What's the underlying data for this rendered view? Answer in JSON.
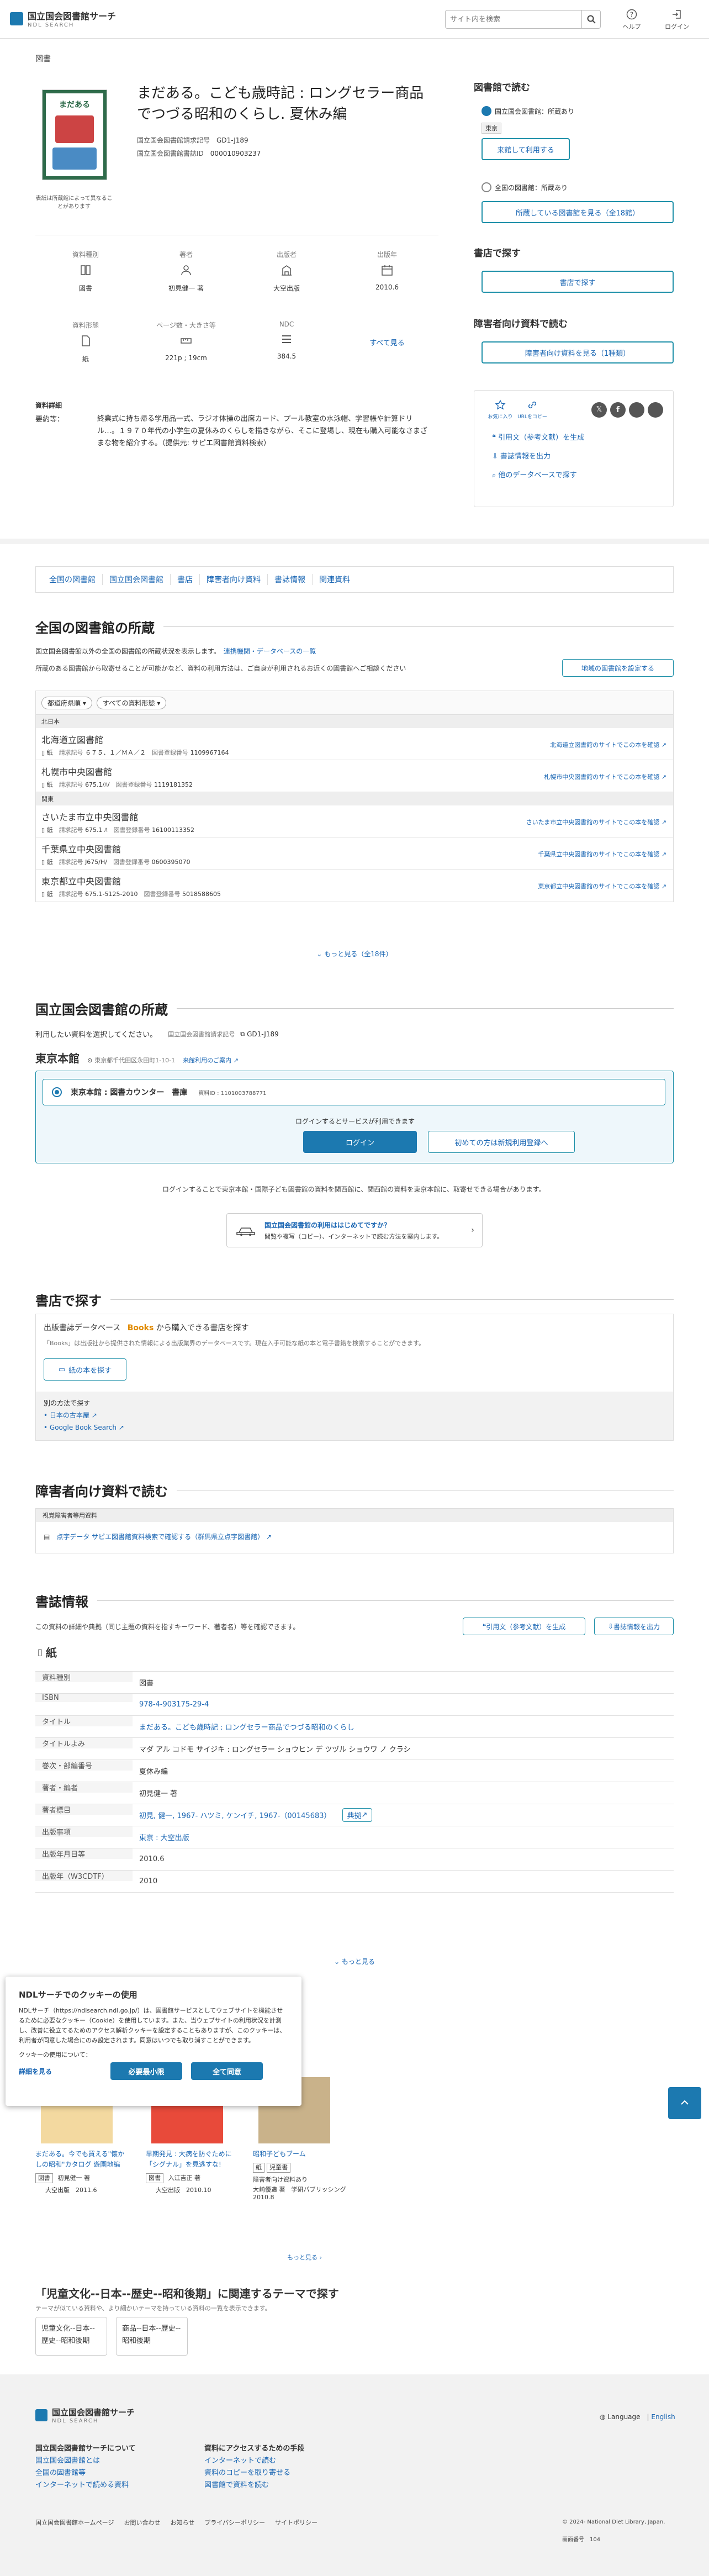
{
  "header": {
    "logo_ja": "国立国会図書館サーチ",
    "logo_en": "NDL SEARCH",
    "search_placeholder": "サイト内を検索",
    "help": "ヘルプ",
    "login": "ログイン"
  },
  "breadcrumb": "図書",
  "book": {
    "title": "まだある。こども歳時記 : ロングセラー商品でつづる昭和のくらし. 夏休み編",
    "call_label": "国立国会図書館請求記号",
    "call": "GD1-J189",
    "reg_label": "国立国会図書館書誌ID",
    "reg": "000010903237",
    "cover_note": "表紙は所蔵館によって異なることがあります",
    "cover_text": "まだある",
    "summary_label": "資料詳細",
    "summary_key": "要約等：",
    "summary": "終業式に持ち帰る学用品一式、ラジオ体操の出席カード、プール教室の水泳帽、学習帳や計算ドリル…。１９７０年代の小学生の夏休みのくらしを描きながら、そこに登場し、現在も購入可能なさまざまな物を紹介する。（提供元: サピエ図書館資料検索）"
  },
  "facets": [
    {
      "label": "資料種別",
      "value": "図書",
      "icon": "book-icon"
    },
    {
      "label": "著者",
      "value": "初見健一 著",
      "icon": "person-icon"
    },
    {
      "label": "出版者",
      "value": "大空出版",
      "icon": "building-icon"
    },
    {
      "label": "出版年",
      "value": "2010.6",
      "icon": "calendar-icon"
    },
    {
      "label": "資料形態",
      "value": "紙",
      "icon": "paper-icon"
    },
    {
      "label": "ページ数・大きさ等",
      "value": "221p ; 19cm",
      "icon": "ruler-icon"
    },
    {
      "label": "NDC",
      "value": "384.5",
      "icon": "ndc-icon"
    }
  ],
  "see_all": "すべて見る",
  "side": {
    "read_title": "図書館で読む",
    "ndl_hold": "国立国会図書館：所蔵あり",
    "tokyo": "東京",
    "visit_btn": "来館して利用する",
    "pub_hold": "全国の図書館：所蔵あり",
    "pub_btn": "所蔵している図書館を見る（全18館）",
    "store_title": "書店で探す",
    "store_btn": "書店で探す",
    "dis_title": "障害者向け資料で読む",
    "dis_btn": "障害者向け資料を見る（1種類）",
    "fav": "お気に入り",
    "url": "URLをコピー",
    "cite": "引用文（参考文献）を生成",
    "export": "書誌情報を出力",
    "other_db": "他のデータベースで探す"
  },
  "tabs": [
    "全国の図書館",
    "国立国会図書館",
    "書店",
    "障害者向け資料",
    "書誌情報",
    "関連資料"
  ],
  "national": {
    "title": "全国の図書館の所蔵",
    "desc": "国立国会図書館以外の全国の図書館の所蔵状況を表示します。",
    "link": "連携機関・データベースの一覧",
    "desc2": "所蔵のある図書館から取寄せることが可能かなど、資料の利用方法は、ご自身が利用されるお近くの図書館へご相談ください",
    "set_btn": "地域の図書館を設定する",
    "filter1": "都道府県順",
    "filter2": "すべての資料形態",
    "groups": [
      {
        "region": "北日本",
        "libs": [
          {
            "name": "北海道立図書館",
            "kind": "紙",
            "call_label": "請求記号",
            "call": "６７５．１／ＭＡ／２",
            "reg_label": "図書登録番号",
            "reg": "1109967164",
            "link": "北海道立図書館のサイトでこの本を確認"
          },
          {
            "name": "札幌市中央図書館",
            "kind": "紙",
            "call_label": "請求記号",
            "call": "675.1/ﾊ/",
            "reg_label": "図書登録番号",
            "reg": "1119181352",
            "link": "札幌市中央図書館のサイトでこの本を確認"
          }
        ]
      },
      {
        "region": "関東",
        "libs": [
          {
            "name": "さいたま市立中央図書館",
            "kind": "紙",
            "call_label": "請求記号",
            "call": "675.1 ﾊ",
            "reg_label": "図書登録番号",
            "reg": "16100113352",
            "link": "さいたま市立中央図書館のサイトでこの本を確認"
          },
          {
            "name": "千葉県立中央図書館",
            "kind": "紙",
            "call_label": "請求記号",
            "call": "J675/H/",
            "reg_label": "図書登録番号",
            "reg": "0600395070",
            "link": "千葉県立中央図書館のサイトでこの本を確認"
          },
          {
            "name": "東京都立中央図書館",
            "kind": "紙",
            "call_label": "請求記号",
            "call": "675.1-5125-2010",
            "reg_label": "図書登録番号",
            "reg": "5018588605",
            "link": "東京都立中央図書館のサイトでこの本を確認"
          }
        ]
      }
    ],
    "more": "もっと見る（全18件）"
  },
  "ndl": {
    "title": "国立国会図書館の所蔵",
    "desc": "利用したい資料を選択してください。",
    "call_label": "国立国会図書館請求記号",
    "call": "GD1-J189",
    "branch": "東京本館",
    "address": "東京都千代田区永田町1-10-1",
    "howto": "来館利用のご案内",
    "item": "東京本館 : 図書カウンター　書庫",
    "item_id": "資料ID : 1101003788771",
    "login_note": "ログインするとサービスが利用できます",
    "login_btn": "ログイン",
    "register_btn": "初めての方は新規利用登録へ",
    "note": "ログインすることで東京本館・国際子ども図書館の資料を関西館に、関西館の資料を東京本館に、取寄せできる場合があります。",
    "guide_title": "国立国会図書館の利用ははじめてですか？",
    "guide_text": "閲覧や複写（コピー）、インターネットで読む方法を案内します。"
  },
  "store": {
    "title": "書店で探す",
    "db": "出版書誌データベース",
    "books_logo": "Books",
    "db_suffix": "から購入できる書店を探す",
    "desc": "「Books」は出版社から提供された情報による出版業界のデータベースです。現在入手可能な紙の本と電子書籍を検索することができます。",
    "btn": "紙の本を探す",
    "other": "別の方法で探す",
    "l1": "日本の古本屋",
    "l2": "Google Book Search"
  },
  "disab": {
    "title": "障害者向け資料で読む",
    "head": "視覚障害者等用資料",
    "link": "点字データ サピエ図書館資料検索で確認する（群馬県立点字図書館）"
  },
  "biblio": {
    "title": "書誌情報",
    "desc": "この資料の詳細や典拠（同じ主題の資料を指すキーワード、著者名）等を確認できます。",
    "cite": "引用文（参考文献）を生成",
    "export": "書誌情報を出力",
    "kind": "紙",
    "rows": [
      {
        "k": "資料種別",
        "v": "図書"
      },
      {
        "k": "ISBN",
        "v": "978-4-903175-29-4"
      },
      {
        "k": "タイトル",
        "v": "まだある。こども歳時記 : ロングセラー商品でつづる昭和のくらし"
      },
      {
        "k": "タイトルよみ",
        "v": "マダ アル コドモ サイジキ : ロングセラー ショウヒン デ ツヅル ショウワ ノ クラシ"
      },
      {
        "k": "巻次・部編番号",
        "v": "夏休み編"
      },
      {
        "k": "著者・編者",
        "v": "初見健一 著"
      },
      {
        "k": "著者標目",
        "v": "初見, 健一, 1967- ハツミ, ケンイチ, 1967-（00145683）"
      },
      {
        "k": "出版事項",
        "v": "東京 : 大空出版"
      },
      {
        "k": "出版年月日等",
        "v": "2010.6"
      },
      {
        "k": "出版年（W3CDTF）",
        "v": "2010"
      }
    ],
    "authority": "典拠",
    "more": "もっと見る"
  },
  "related": {
    "books": [
      {
        "t": "まだある。今でも買える\"懐かしの昭和\"カタログ 遊園地編",
        "tags": [
          "図書"
        ],
        "a": "初見健一 著",
        "p": "大空出版",
        "y": "2011.6"
      },
      {
        "t": "早期発見 : 大病を防ぐために「シグナル」を見逃すな!",
        "tags": [
          "図書"
        ],
        "a": "入江吉正 著",
        "p": "大空出版",
        "y": "2010.10"
      },
      {
        "t": "昭和子どもブーム",
        "tags": [
          "紙",
          "児童書"
        ],
        "a": "大崎優造 著　学研パブリッシング",
        "p": "障害者向け資料あり",
        "y": "2010.8"
      }
    ],
    "more": "もっと見る",
    "theme_title": "「児童文化--日本--歴史--昭和後期」に関連するテーマで探す",
    "theme_desc": "テーマが似ている資料や、より細かいテーマを持っている資料の一覧を表示できます。",
    "themes": [
      "児童文化--日本--歴史--昭和後期",
      "商品--日本--歴史--昭和後期"
    ]
  },
  "cookie": {
    "title": "NDLサーチでのクッキーの使用",
    "body": "NDLサーチ（https://ndlsearch.ndl.go.jp/）は、図書館サービスとしてウェブサイトを機能させるために必要なクッキー（Cookie）を使用しています。また、当ウェブサイトの利用状況を計測し、改善に役立てるためのアクセス解析クッキーを設定することもありますが、このクッキーは、利用者が同意した場合にのみ設定されます。同意はいつでも取り消すことができます。",
    "q": "クッキーの使用について：",
    "detail": "詳細を見る",
    "min": "必要最小限",
    "all": "全て同意"
  },
  "footer": {
    "logo_ja": "国立国会図書館サーチ",
    "logo_en": "NDL SEARCH",
    "lang": "Language",
    "en": "English",
    "c1": "国立国会図書館サーチについて",
    "c1l": [
      "国立国会図書館とは",
      "全国の図書館等",
      "インターネットで読める資料"
    ],
    "c2": "資料にアクセスするための手段",
    "c2l": [
      "インターネットで読む",
      "資料のコピーを取り寄せる",
      "図書館で資料を読む"
    ],
    "bottom": [
      "国立国会図書館ホームページ",
      "お問い合わせ",
      "お知らせ",
      "プライバシーポリシー",
      "サイトポリシー"
    ],
    "copy": "© 2024- National Diet Library, Japan.",
    "page_label": "画面番号",
    "page": "104"
  }
}
